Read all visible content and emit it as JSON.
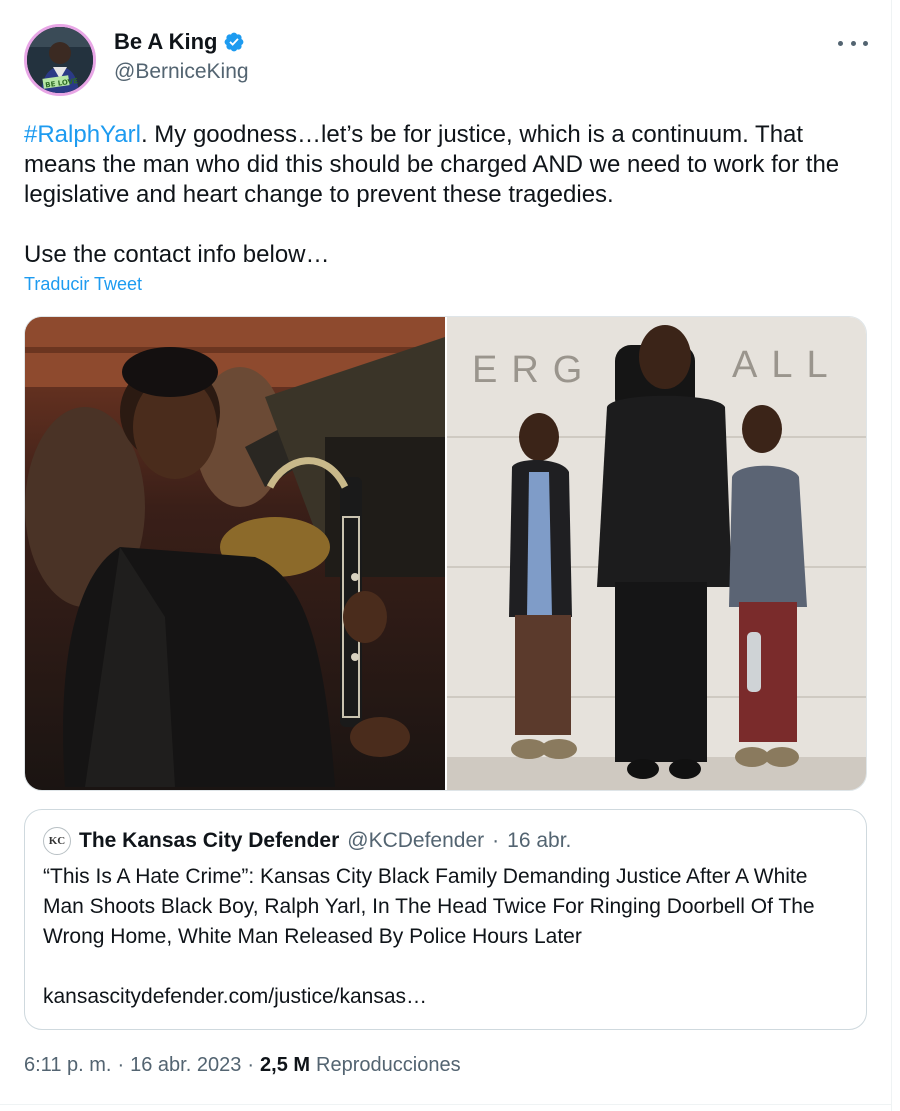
{
  "author": {
    "name": "Be A King",
    "handle": "@BerniceKing",
    "avatar_badge_text": "BE LOVE",
    "verified": true,
    "accent_color": "#1d9bf0"
  },
  "tweet": {
    "hashtag": "#RalphYarl",
    "text_after_hashtag": ". My goodness…let’s be for justice, which is a continuum. That means the man who did this should be charged AND we need to work for the legislative and heart change to prevent these tragedies.",
    "text_second": "Use the contact info below…",
    "translate_label": "Traducir Tweet"
  },
  "media": {
    "photo2_wall_text_left": "ERG",
    "photo2_wall_text_right": "ALL"
  },
  "quote": {
    "avatar_text": "KC",
    "name": "The Kansas City Defender",
    "handle": "@KCDefender",
    "separator": "·",
    "date": "16 abr.",
    "text": "“This Is A Hate Crime”: Kansas City Black Family Demanding Justice After A White Man Shoots Black Boy, Ralph Yarl, In The Head Twice For Ringing Doorbell Of The Wrong Home, White Man Released By Police Hours Later",
    "link": "kansascitydefender.com/justice/kansas…"
  },
  "meta": {
    "time": "6:11 p. m.",
    "sep1": "·",
    "date": "16 abr. 2023",
    "sep2": "·",
    "views_count": "2,5 M",
    "views_label": "Reproducciones"
  },
  "icons": {
    "verified": "verified-badge-icon",
    "more": "more-options-icon"
  }
}
